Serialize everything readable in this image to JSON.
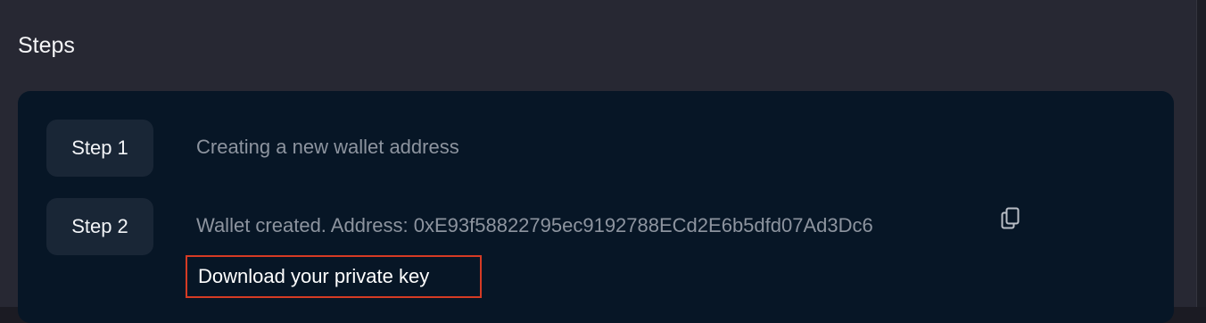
{
  "title": "Steps",
  "steps": [
    {
      "label": "Step 1",
      "text": "Creating a new wallet address"
    },
    {
      "label": "Step 2",
      "text": "Wallet created. Address: 0xE93f58822795ec9192788ECd2E6b5dfd07Ad3Dc6"
    }
  ],
  "download": {
    "label": "Download your private key",
    "highlight_color": "#d63b24"
  },
  "icons": {
    "copy": "copy-icon"
  },
  "colors": {
    "background": "#272833",
    "card": "#071626",
    "step_pill": "#192636",
    "muted_text": "#8d949f"
  }
}
